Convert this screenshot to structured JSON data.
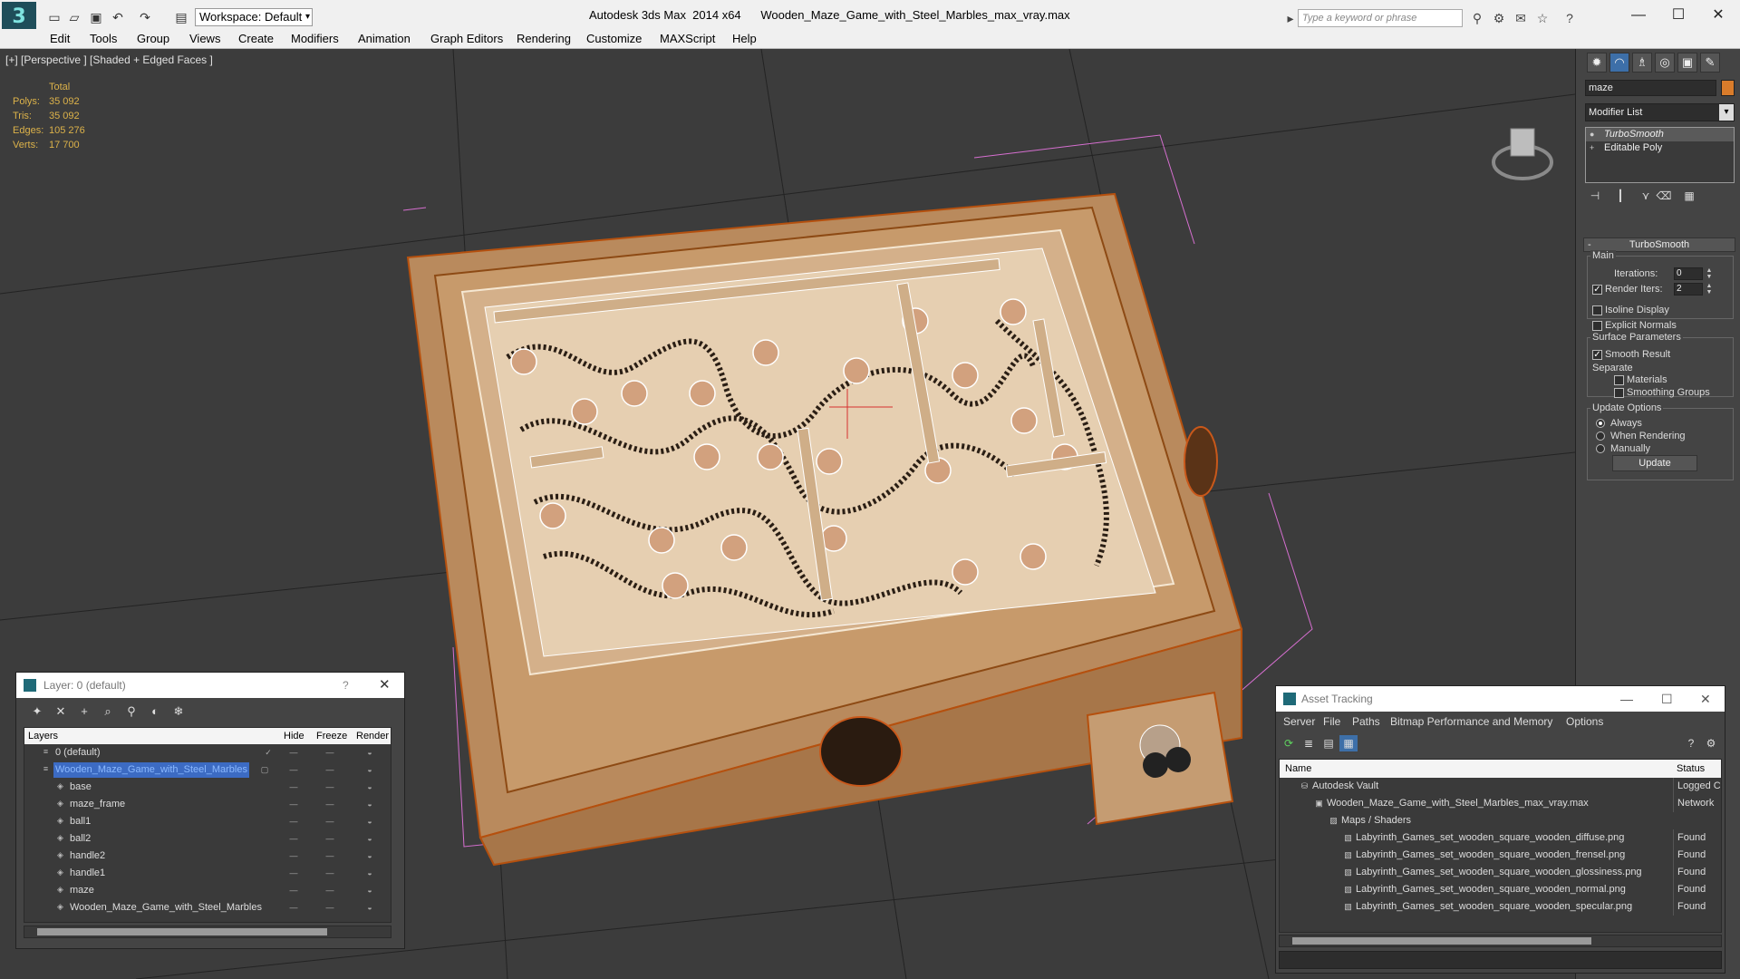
{
  "app": {
    "title": "Autodesk 3ds Max  2014 x64      Wooden_Maze_Game_with_Steel_Marbles_max_vray.max",
    "logo": "3",
    "workspace": "Workspace: Default",
    "search_placeholder": "Type a keyword or phrase",
    "window_controls": [
      "—",
      "☐",
      "✕"
    ]
  },
  "menu": [
    "Edit",
    "Tools",
    "Group",
    "Views",
    "Create",
    "Modifiers",
    "Animation",
    "Graph Editors",
    "Rendering",
    "Customize",
    "MAXScript",
    "Help"
  ],
  "viewport": {
    "label": "[+] [Perspective ] [Shaded + Edged Faces ]",
    "stats": {
      "header": "Total",
      "rows": [
        {
          "label": "Polys:",
          "value": "35 092"
        },
        {
          "label": "Tris:",
          "value": "35 092"
        },
        {
          "label": "Edges:",
          "value": "105 276"
        },
        {
          "label": "Verts:",
          "value": "17 700"
        }
      ]
    }
  },
  "command_panel": {
    "object_name": "maze",
    "object_color": "#d97c2b",
    "modifier_list": "Modifier List",
    "stack": [
      "TurboSmooth",
      "Editable Poly"
    ],
    "rollout_title": "TurboSmooth",
    "main_group": "Main",
    "iterations_label": "Iterations:",
    "iterations_value": "0",
    "render_iters_label": "Render Iters:",
    "render_iters_value": "2",
    "isoline_display": "Isoline Display",
    "explicit_normals": "Explicit Normals",
    "surface_params": "Surface Parameters",
    "smooth_result": "Smooth Result",
    "separate": "Separate",
    "materials": "Materials",
    "smoothing_groups": "Smoothing Groups",
    "update_options": "Update Options",
    "always": "Always",
    "when_rendering": "When Rendering",
    "manually": "Manually",
    "update_button": "Update"
  },
  "layer_window": {
    "title": "Layer: 0 (default)",
    "help": "?",
    "close": "✕",
    "columns": {
      "layers": "Layers",
      "hide": "Hide",
      "freeze": "Freeze",
      "render": "Render"
    },
    "rows": [
      {
        "name": "0 (default)",
        "level": 0,
        "checked": true
      },
      {
        "name": "Wooden_Maze_Game_with_Steel_Marbles",
        "level": 0,
        "selected": true
      },
      {
        "name": "base",
        "level": 1
      },
      {
        "name": "maze_frame",
        "level": 1
      },
      {
        "name": "ball1",
        "level": 1
      },
      {
        "name": "ball2",
        "level": 1
      },
      {
        "name": "handle2",
        "level": 1
      },
      {
        "name": "handle1",
        "level": 1
      },
      {
        "name": "maze",
        "level": 1
      },
      {
        "name": "Wooden_Maze_Game_with_Steel_Marbles",
        "level": 1
      }
    ]
  },
  "asset_window": {
    "title": "Asset Tracking",
    "menu": [
      "Server",
      "File",
      "Paths",
      "Bitmap Performance and Memory",
      "Options"
    ],
    "columns": {
      "name": "Name",
      "status": "Status"
    },
    "rows": [
      {
        "name": "Autodesk Vault",
        "level": 0,
        "status": "Logged C"
      },
      {
        "name": "Wooden_Maze_Game_with_Steel_Marbles_max_vray.max",
        "level": 1,
        "status": "Network"
      },
      {
        "name": "Maps / Shaders",
        "level": 2,
        "status": ""
      },
      {
        "name": "Labyrinth_Games_set_wooden_square_wooden_diffuse.png",
        "level": 3,
        "status": "Found"
      },
      {
        "name": "Labyrinth_Games_set_wooden_square_wooden_frensel.png",
        "level": 3,
        "status": "Found"
      },
      {
        "name": "Labyrinth_Games_set_wooden_square_wooden_glossiness.png",
        "level": 3,
        "status": "Found"
      },
      {
        "name": "Labyrinth_Games_set_wooden_square_wooden_normal.png",
        "level": 3,
        "status": "Found"
      },
      {
        "name": "Labyrinth_Games_set_wooden_square_wooden_specular.png",
        "level": 3,
        "status": "Found"
      }
    ]
  }
}
